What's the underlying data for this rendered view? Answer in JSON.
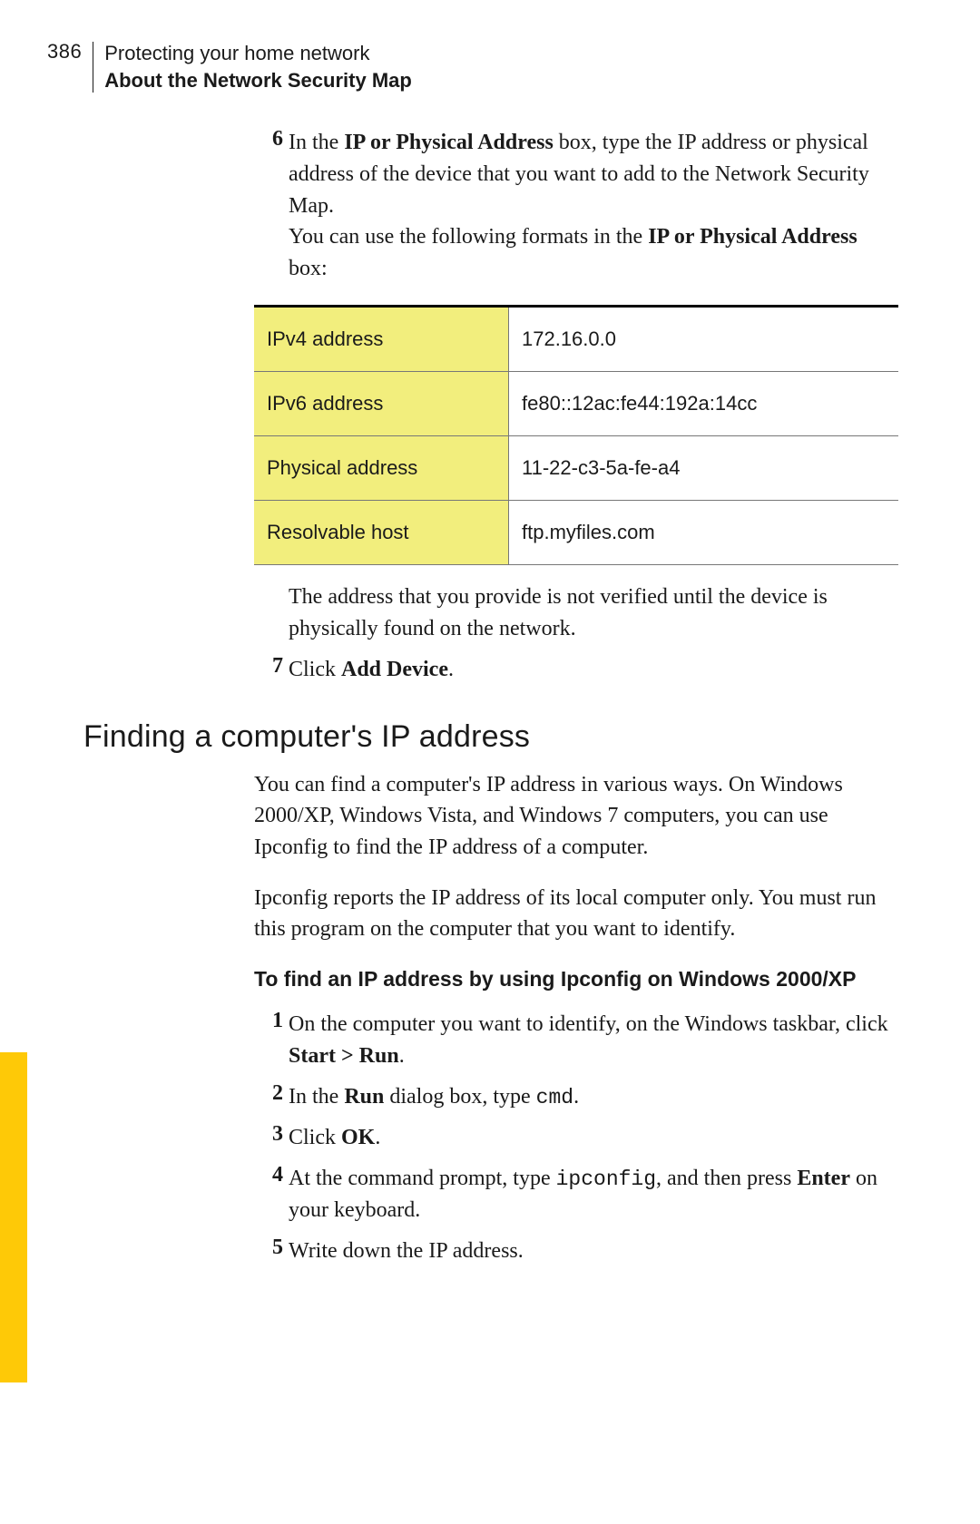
{
  "page_number": "386",
  "chapter_title": "Protecting your home network",
  "section_title": "About the Network Security Map",
  "step6": {
    "num": "6",
    "text_a": "In the ",
    "bold_a": "IP or Physical Address",
    "text_b": " box, type the IP address or physical address of the device that you want to add to the Network Security Map.",
    "text_c": "You can use the following formats in the ",
    "bold_b": "IP or Physical Address",
    "text_d": " box:"
  },
  "table": [
    {
      "label": "IPv4 address",
      "value": "172.16.0.0"
    },
    {
      "label": "IPv6 address",
      "value": "fe80::12ac:fe44:192a:14cc"
    },
    {
      "label": "Physical address",
      "value": "11-22-c3-5a-fe-a4"
    },
    {
      "label": "Resolvable host",
      "value": "ftp.myfiles.com"
    }
  ],
  "after_table_note": "The address that you provide is not verified until the device is physically found on the network.",
  "step7": {
    "num": "7",
    "text_a": "Click ",
    "bold_a": "Add Device",
    "text_b": "."
  },
  "heading2": "Finding a computer's IP address",
  "para1": "You can find a computer's IP address in various ways. On Windows 2000/XP, Windows Vista, and Windows 7 computers, you can use Ipconfig to find the IP address of a computer.",
  "para2": "Ipconfig reports the IP address of its local computer only. You must run this program on the computer that you want to identify.",
  "subhead": "To find an IP address by using Ipconfig on Windows 2000/XP",
  "steps": {
    "s1": {
      "num": "1",
      "t1": "On the computer you want to identify, on the Windows taskbar, click ",
      "b1": "Start > Run",
      "t2": "."
    },
    "s2": {
      "num": "2",
      "t1": "In the ",
      "b1": "Run",
      "t2": " dialog box, type ",
      "m1": "cmd",
      "t3": "."
    },
    "s3": {
      "num": "3",
      "t1": "Click ",
      "b1": "OK",
      "t2": "."
    },
    "s4": {
      "num": "4",
      "t1": "At the command prompt, type ",
      "m1": "ipconfig",
      "t2": ", and then press ",
      "b1": "Enter",
      "t3": " on your keyboard."
    },
    "s5": {
      "num": "5",
      "t1": "Write down the IP address."
    }
  }
}
